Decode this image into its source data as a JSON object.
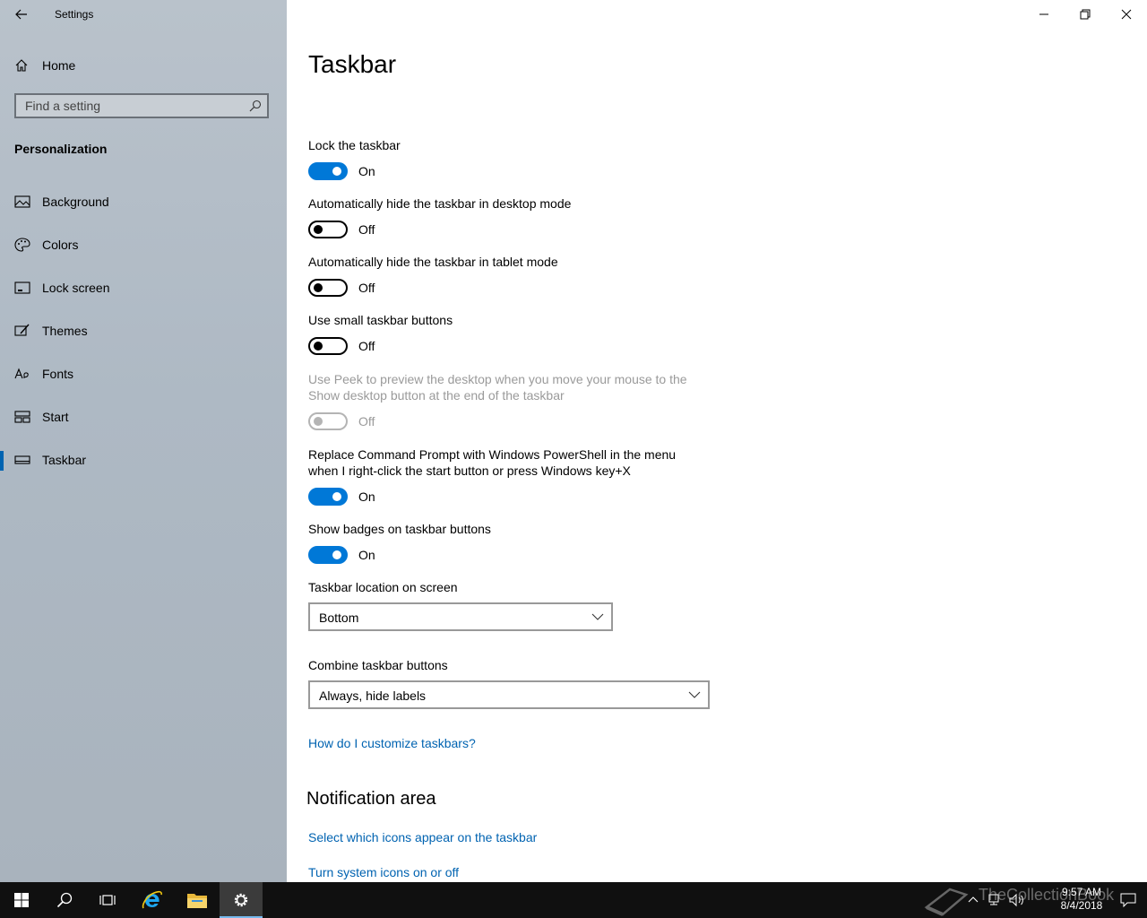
{
  "window": {
    "title": "Settings"
  },
  "sidebar": {
    "home_label": "Home",
    "search_placeholder": "Find a setting",
    "section_title": "Personalization",
    "items": [
      {
        "label": "Background",
        "icon": "picture-icon",
        "active": false
      },
      {
        "label": "Colors",
        "icon": "palette-icon",
        "active": false
      },
      {
        "label": "Lock screen",
        "icon": "lock-screen-icon",
        "active": false
      },
      {
        "label": "Themes",
        "icon": "brush-icon",
        "active": false
      },
      {
        "label": "Fonts",
        "icon": "font-icon",
        "active": false
      },
      {
        "label": "Start",
        "icon": "start-tiles-icon",
        "active": false
      },
      {
        "label": "Taskbar",
        "icon": "taskbar-icon",
        "active": true
      }
    ],
    "accent_color": "#0063b1"
  },
  "main": {
    "title": "Taskbar",
    "settings": {
      "lock": {
        "label": "Lock the taskbar",
        "state": "On"
      },
      "autohide_desktop": {
        "label": "Automatically hide the taskbar in desktop mode",
        "state": "Off"
      },
      "autohide_tablet": {
        "label": "Automatically hide the taskbar in tablet mode",
        "state": "Off"
      },
      "small_buttons": {
        "label": "Use small taskbar buttons",
        "state": "Off"
      },
      "peek": {
        "label": "Use Peek to preview the desktop when you move your mouse to the Show desktop button at the end of the taskbar",
        "state": "Off",
        "disabled": true
      },
      "powershell": {
        "label": "Replace Command Prompt with Windows PowerShell in the menu when I right-click the start button or press Windows key+X",
        "state": "On"
      },
      "badges": {
        "label": "Show badges on taskbar buttons",
        "state": "On"
      }
    },
    "location": {
      "label": "Taskbar location on screen",
      "value": "Bottom"
    },
    "combine": {
      "label": "Combine taskbar buttons",
      "value": "Always, hide labels"
    },
    "help_link": "How do I customize taskbars?",
    "notification": {
      "title": "Notification area",
      "link_icons": "Select which icons appear on the taskbar",
      "link_system": "Turn system icons on or off"
    },
    "toggle_on_color": "#0078d7",
    "link_color": "#0063b1"
  },
  "taskbar": {
    "time": "9:57 AM",
    "date": "8/4/2018",
    "watermark": "TheCollectionBook"
  }
}
